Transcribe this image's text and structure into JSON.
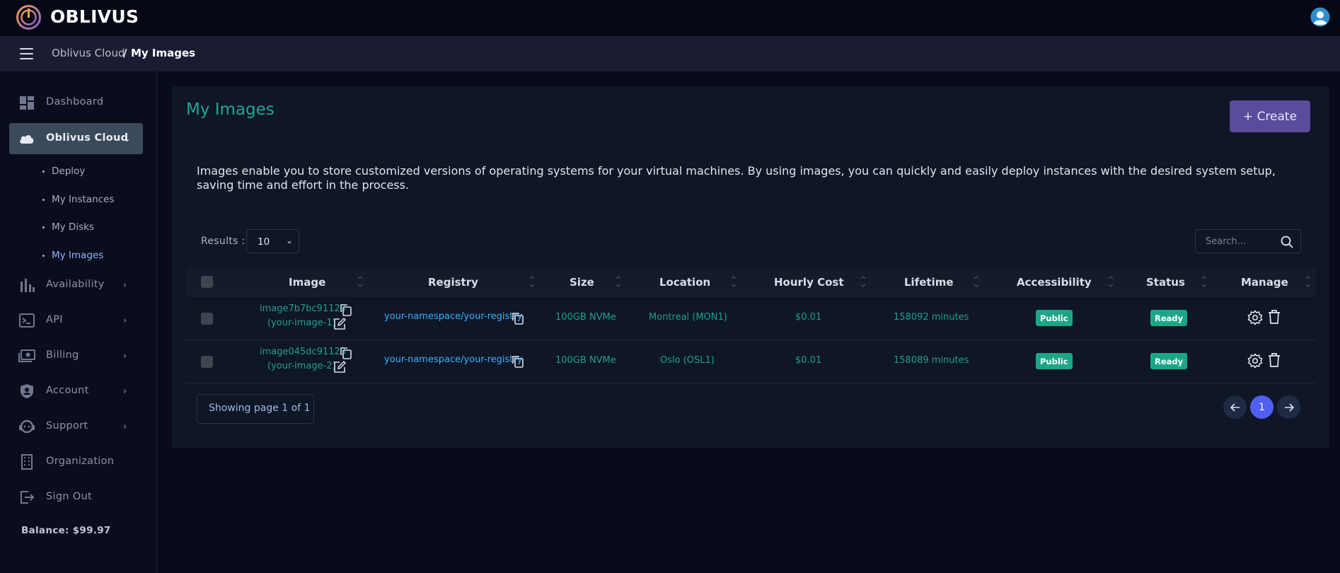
{
  "header": {
    "brand": "OBLIVUS",
    "breadcrumb": [
      "Oblivus Cloud",
      "/",
      "My Images"
    ]
  },
  "sidebar": {
    "items": [
      {
        "label": "Dashboard",
        "icon": "dashboard-icon"
      },
      {
        "label": "Oblivus Cloud",
        "icon": "cloud-icon",
        "expanded": true
      },
      {
        "label": "Availability",
        "icon": "bar-chart-icon"
      },
      {
        "label": "API",
        "icon": "terminal-icon"
      },
      {
        "label": "Billing",
        "icon": "billing-icon"
      },
      {
        "label": "Account",
        "icon": "shield-user-icon"
      },
      {
        "label": "Support",
        "icon": "support-icon"
      },
      {
        "label": "Organization",
        "icon": "building-icon"
      },
      {
        "label": "Sign Out",
        "icon": "sign-out-icon"
      }
    ],
    "subitems": [
      "Deploy",
      "My Instances",
      "My Disks",
      "My Images"
    ],
    "current_subitem": "My Images",
    "balance": "Balance: $99.97"
  },
  "main": {
    "title": "My Images",
    "create_label": "+ Create",
    "description": "Images enable you to store customized versions of operating systems for your virtual machines. By using images, you can quickly and easily deploy instances with the desired system setup, saving time and effort in the process.",
    "results_label": "Results :",
    "results_value": "10",
    "search_placeholder": "Search..."
  },
  "table": {
    "columns": [
      "Image",
      "Registry",
      "Size",
      "Location",
      "Hourly Cost",
      "Lifetime",
      "Accessibility",
      "Status",
      "Manage"
    ],
    "rows": [
      {
        "image_id": "image7b7bc91123",
        "image_name": "(your-image-1)",
        "registry": "your-namespace/your-registry",
        "size": "100GB NVMe",
        "location": "Montreal (MON1)",
        "hourly_cost": "$0.01",
        "lifetime": "158092 minutes",
        "accessibility": "Public",
        "status": "Ready"
      },
      {
        "image_id": "image045dc91123",
        "image_name": "(your-image-2)",
        "registry": "your-namespace/your-registry",
        "size": "100GB NVMe",
        "location": "Oslo (OSL1)",
        "hourly_cost": "$0.01",
        "lifetime": "158089 minutes",
        "accessibility": "Public",
        "status": "Ready"
      }
    ]
  },
  "pagination": {
    "info": "Showing page 1 of 1",
    "current_page": "1"
  },
  "colors": {
    "accent_teal": "#21a596",
    "create_button": "#5a4b9c",
    "badge_green": "#1aa787",
    "pagination_active": "#4f5ff0",
    "link_blue": "#35b3ff"
  }
}
